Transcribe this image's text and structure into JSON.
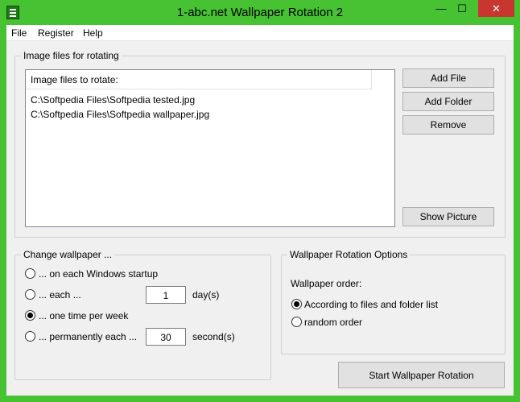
{
  "window": {
    "title": "1-abc.net Wallpaper Rotation 2",
    "min_glyph": "—",
    "max_glyph": "☐",
    "close_glyph": "✕"
  },
  "menu": [
    "File",
    "Register",
    "Help"
  ],
  "image_group": {
    "title": "Image files for rotating",
    "list_header": "Image files to rotate:",
    "files": [
      "C:\\Softpedia Files\\Softpedia tested.jpg",
      "C:\\Softpedia Files\\Softpedia wallpaper.jpg"
    ],
    "buttons": {
      "add_file": "Add File",
      "add_folder": "Add Folder",
      "remove": "Remove",
      "show_picture": "Show Picture"
    }
  },
  "change_group": {
    "title": "Change wallpaper ...",
    "options": [
      {
        "label": "... on each Windows startup",
        "checked": false
      },
      {
        "label": "... each ...",
        "checked": false
      },
      {
        "label": "... one time per week",
        "checked": true
      },
      {
        "label": "... permanently each ...",
        "checked": false
      }
    ],
    "days_value": "1",
    "days_unit": "day(s)",
    "seconds_value": "30",
    "seconds_unit": "second(s)"
  },
  "options_group": {
    "title": "Wallpaper Rotation Options",
    "order_label": "Wallpaper order:",
    "orders": [
      {
        "label": "According to files and folder list",
        "checked": true
      },
      {
        "label": "random order",
        "checked": false
      }
    ]
  },
  "start_button": "Start Wallpaper Rotation"
}
